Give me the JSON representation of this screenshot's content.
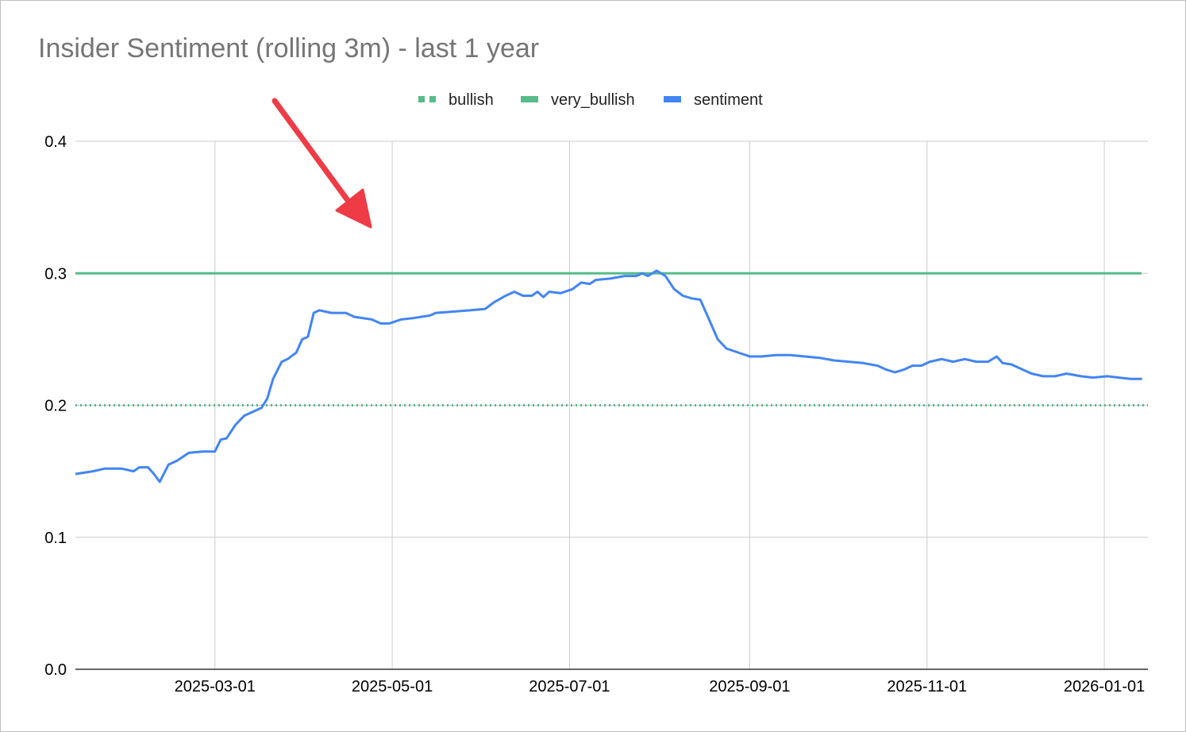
{
  "chart_data": {
    "type": "line",
    "title": "Insider Sentiment (rolling 3m) - last 1 year",
    "xlabel": "",
    "ylabel": "",
    "ylim": [
      0,
      0.4
    ],
    "yticks": [
      "0.0",
      "0.1",
      "0.2",
      "0.3",
      "0.4"
    ],
    "xlim": [
      "2025-01-12",
      "2026-01-16"
    ],
    "xticks": [
      "2025-03-01",
      "2025-05-01",
      "2025-07-01",
      "2025-09-01",
      "2025-11-01",
      "2026-01-01"
    ],
    "grid": true,
    "legend": "top-center",
    "series": [
      {
        "name": "bullish",
        "style": "dotted",
        "color": "#57bb8a",
        "constant": 0.2
      },
      {
        "name": "very_bullish",
        "style": "solid",
        "color": "#57bb8a",
        "constant": 0.3
      },
      {
        "name": "sentiment",
        "style": "solid",
        "color": "#4285f4",
        "points": [
          [
            "2025-01-12",
            0.148
          ],
          [
            "2025-01-18",
            0.15
          ],
          [
            "2025-01-22",
            0.152
          ],
          [
            "2025-01-28",
            0.152
          ],
          [
            "2025-02-01",
            0.15
          ],
          [
            "2025-02-03",
            0.153
          ],
          [
            "2025-02-06",
            0.153
          ],
          [
            "2025-02-08",
            0.148
          ],
          [
            "2025-02-10",
            0.142
          ],
          [
            "2025-02-13",
            0.155
          ],
          [
            "2025-02-16",
            0.158
          ],
          [
            "2025-02-20",
            0.164
          ],
          [
            "2025-02-25",
            0.165
          ],
          [
            "2025-03-01",
            0.165
          ],
          [
            "2025-03-03",
            0.174
          ],
          [
            "2025-03-05",
            0.175
          ],
          [
            "2025-03-08",
            0.185
          ],
          [
            "2025-03-11",
            0.192
          ],
          [
            "2025-03-14",
            0.195
          ],
          [
            "2025-03-17",
            0.198
          ],
          [
            "2025-03-19",
            0.205
          ],
          [
            "2025-03-21",
            0.22
          ],
          [
            "2025-03-24",
            0.233
          ],
          [
            "2025-03-26",
            0.235
          ],
          [
            "2025-03-29",
            0.24
          ],
          [
            "2025-03-31",
            0.25
          ],
          [
            "2025-04-02",
            0.252
          ],
          [
            "2025-04-04",
            0.27
          ],
          [
            "2025-04-06",
            0.272
          ],
          [
            "2025-04-10",
            0.27
          ],
          [
            "2025-04-15",
            0.27
          ],
          [
            "2025-04-18",
            0.267
          ],
          [
            "2025-04-24",
            0.265
          ],
          [
            "2025-04-27",
            0.262
          ],
          [
            "2025-04-30",
            0.262
          ],
          [
            "2025-05-04",
            0.265
          ],
          [
            "2025-05-08",
            0.266
          ],
          [
            "2025-05-14",
            0.268
          ],
          [
            "2025-05-16",
            0.27
          ],
          [
            "2025-05-22",
            0.271
          ],
          [
            "2025-05-28",
            0.272
          ],
          [
            "2025-06-02",
            0.273
          ],
          [
            "2025-06-05",
            0.278
          ],
          [
            "2025-06-09",
            0.283
          ],
          [
            "2025-06-12",
            0.286
          ],
          [
            "2025-06-15",
            0.283
          ],
          [
            "2025-06-18",
            0.283
          ],
          [
            "2025-06-20",
            0.286
          ],
          [
            "2025-06-22",
            0.282
          ],
          [
            "2025-06-24",
            0.286
          ],
          [
            "2025-06-28",
            0.285
          ],
          [
            "2025-07-02",
            0.288
          ],
          [
            "2025-07-05",
            0.293
          ],
          [
            "2025-07-08",
            0.292
          ],
          [
            "2025-07-10",
            0.295
          ],
          [
            "2025-07-15",
            0.296
          ],
          [
            "2025-07-20",
            0.298
          ],
          [
            "2025-07-24",
            0.298
          ],
          [
            "2025-07-26",
            0.3
          ],
          [
            "2025-07-28",
            0.298
          ],
          [
            "2025-07-31",
            0.302
          ],
          [
            "2025-08-03",
            0.298
          ],
          [
            "2025-08-06",
            0.288
          ],
          [
            "2025-08-09",
            0.283
          ],
          [
            "2025-08-12",
            0.281
          ],
          [
            "2025-08-15",
            0.28
          ],
          [
            "2025-08-18",
            0.265
          ],
          [
            "2025-08-21",
            0.25
          ],
          [
            "2025-08-24",
            0.243
          ],
          [
            "2025-08-28",
            0.24
          ],
          [
            "2025-09-01",
            0.237
          ],
          [
            "2025-09-05",
            0.237
          ],
          [
            "2025-09-10",
            0.238
          ],
          [
            "2025-09-15",
            0.238
          ],
          [
            "2025-09-20",
            0.237
          ],
          [
            "2025-09-25",
            0.236
          ],
          [
            "2025-09-30",
            0.234
          ],
          [
            "2025-10-05",
            0.233
          ],
          [
            "2025-10-10",
            0.232
          ],
          [
            "2025-10-15",
            0.23
          ],
          [
            "2025-10-18",
            0.227
          ],
          [
            "2025-10-21",
            0.225
          ],
          [
            "2025-10-24",
            0.227
          ],
          [
            "2025-10-27",
            0.23
          ],
          [
            "2025-10-30",
            0.23
          ],
          [
            "2025-11-02",
            0.233
          ],
          [
            "2025-11-06",
            0.235
          ],
          [
            "2025-11-10",
            0.233
          ],
          [
            "2025-11-14",
            0.235
          ],
          [
            "2025-11-18",
            0.233
          ],
          [
            "2025-11-22",
            0.233
          ],
          [
            "2025-11-25",
            0.237
          ],
          [
            "2025-11-27",
            0.232
          ],
          [
            "2025-11-30",
            0.231
          ],
          [
            "2025-12-03",
            0.228
          ],
          [
            "2025-12-07",
            0.224
          ],
          [
            "2025-12-11",
            0.222
          ],
          [
            "2025-12-15",
            0.222
          ],
          [
            "2025-12-19",
            0.224
          ],
          [
            "2025-12-24",
            0.222
          ],
          [
            "2025-12-28",
            0.221
          ],
          [
            "2026-01-02",
            0.222
          ],
          [
            "2026-01-06",
            0.221
          ],
          [
            "2026-01-10",
            0.22
          ],
          [
            "2026-01-14",
            0.22
          ]
        ]
      }
    ]
  }
}
